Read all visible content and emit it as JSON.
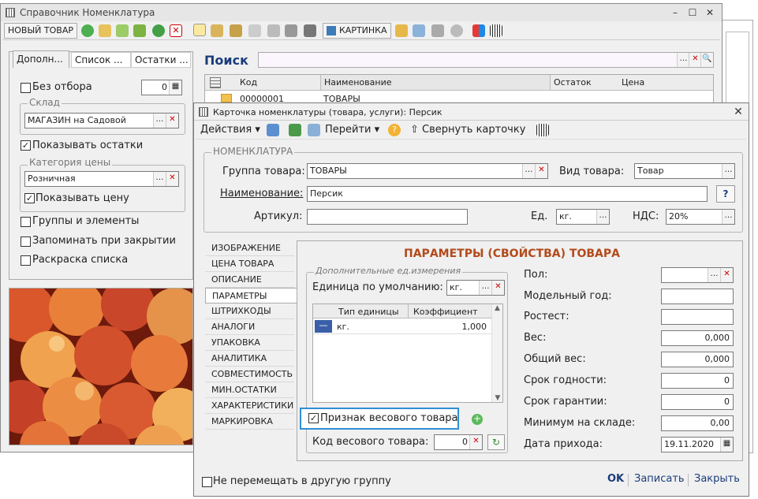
{
  "main_window": {
    "title": "Справочник Номенклатура",
    "toolbar": {
      "new_item": "НОВЫЙ ТОВАР",
      "picture": "КАРТИНКА"
    },
    "tabs": [
      "Дополн...",
      "Список ...",
      "Остатки ..."
    ],
    "no_filter_label": "Без отбора",
    "no_filter_value": "0",
    "warehouse_group": "Склад",
    "warehouse_value": "МАГАЗИН на Садовой",
    "show_stock_label": "Показывать остатки",
    "price_category_group": "Категория цены",
    "price_category_value": "Розничная",
    "show_price_label": "Показывать цену",
    "groups_elements_label": "Группы и элементы",
    "remember_close_label": "Запоминать при закрытии",
    "coloring_label": "Раскраска списка",
    "search_label": "Поиск",
    "table": {
      "columns": [
        "Код",
        "Наименование",
        "Остаток",
        "Цена"
      ],
      "rows": [
        {
          "code": "00000001",
          "name": "ТОВАРЫ"
        }
      ]
    }
  },
  "card": {
    "title": "Карточка номенклатуры (товара, услуги): Персик",
    "toolbar": {
      "actions": "Действия",
      "goto": "Перейти",
      "collapse": "Свернуть карточку"
    },
    "section_title": "НОМЕНКЛАТУРА",
    "group_label": "Группа товара:",
    "group_value": "ТОВАРЫ",
    "kind_label": "Вид товара:",
    "kind_value": "Товар",
    "name_label": "Наименование:",
    "name_value": "Персик",
    "help": "?",
    "article_label": "Артикул:",
    "article_value": "",
    "unit_label": "Ед.",
    "unit_value": "кг.",
    "vat_label": "НДС:",
    "vat_value": "20%",
    "tabs": [
      "ИЗОБРАЖЕНИЕ",
      "ЦЕНА ТОВАРА",
      "ОПИСАНИЕ",
      "ПАРАМЕТРЫ",
      "ШТРИХКОДЫ",
      "АНАЛОГИ",
      "УПАКОВКА",
      "АНАЛИТИКА",
      "СОВМЕСТИМОСТЬ",
      "МИН.ОСТАТКИ",
      "ХАРАКТЕРИСТИКИ",
      "МАРКИРОВКА"
    ],
    "params_title": "ПАРАМЕТРЫ (СВОЙСТВА) ТОВАРА",
    "extra_units_group": "Дополнительные ед.измерения",
    "default_unit_label": "Единица по умолчанию:",
    "default_unit_value": "кг.",
    "units_table": {
      "columns": [
        "Тип единицы",
        "Коэффициент"
      ],
      "rows": [
        {
          "unit": "кг.",
          "coef": "1,000"
        }
      ]
    },
    "weight_flag_label": "Признак весового товара",
    "weight_code_label": "Код весового товара:",
    "weight_code_value": "0",
    "props": [
      {
        "label": "Пол:",
        "value": ""
      },
      {
        "label": "Модельный год:",
        "value": ""
      },
      {
        "label": "Ростест:",
        "value": ""
      },
      {
        "label": "Вес:",
        "value": "0,000"
      },
      {
        "label": "Общий вес:",
        "value": "0,000"
      },
      {
        "label": "Срок годности:",
        "value": "0"
      },
      {
        "label": "Срок гарантии:",
        "value": "0"
      },
      {
        "label": "Минимум на складе:",
        "value": "0,00"
      },
      {
        "label": "Дата прихода:",
        "value": "19.11.2020"
      }
    ],
    "no_move_label": "Не перемещать в другую группу",
    "ok": "OK",
    "save": "Записать",
    "close": "Закрыть"
  },
  "colors": {
    "accent_title": "#b34a1a",
    "highlight_border": "#2f8fd4",
    "tab_blue": "#1a3d7a"
  }
}
